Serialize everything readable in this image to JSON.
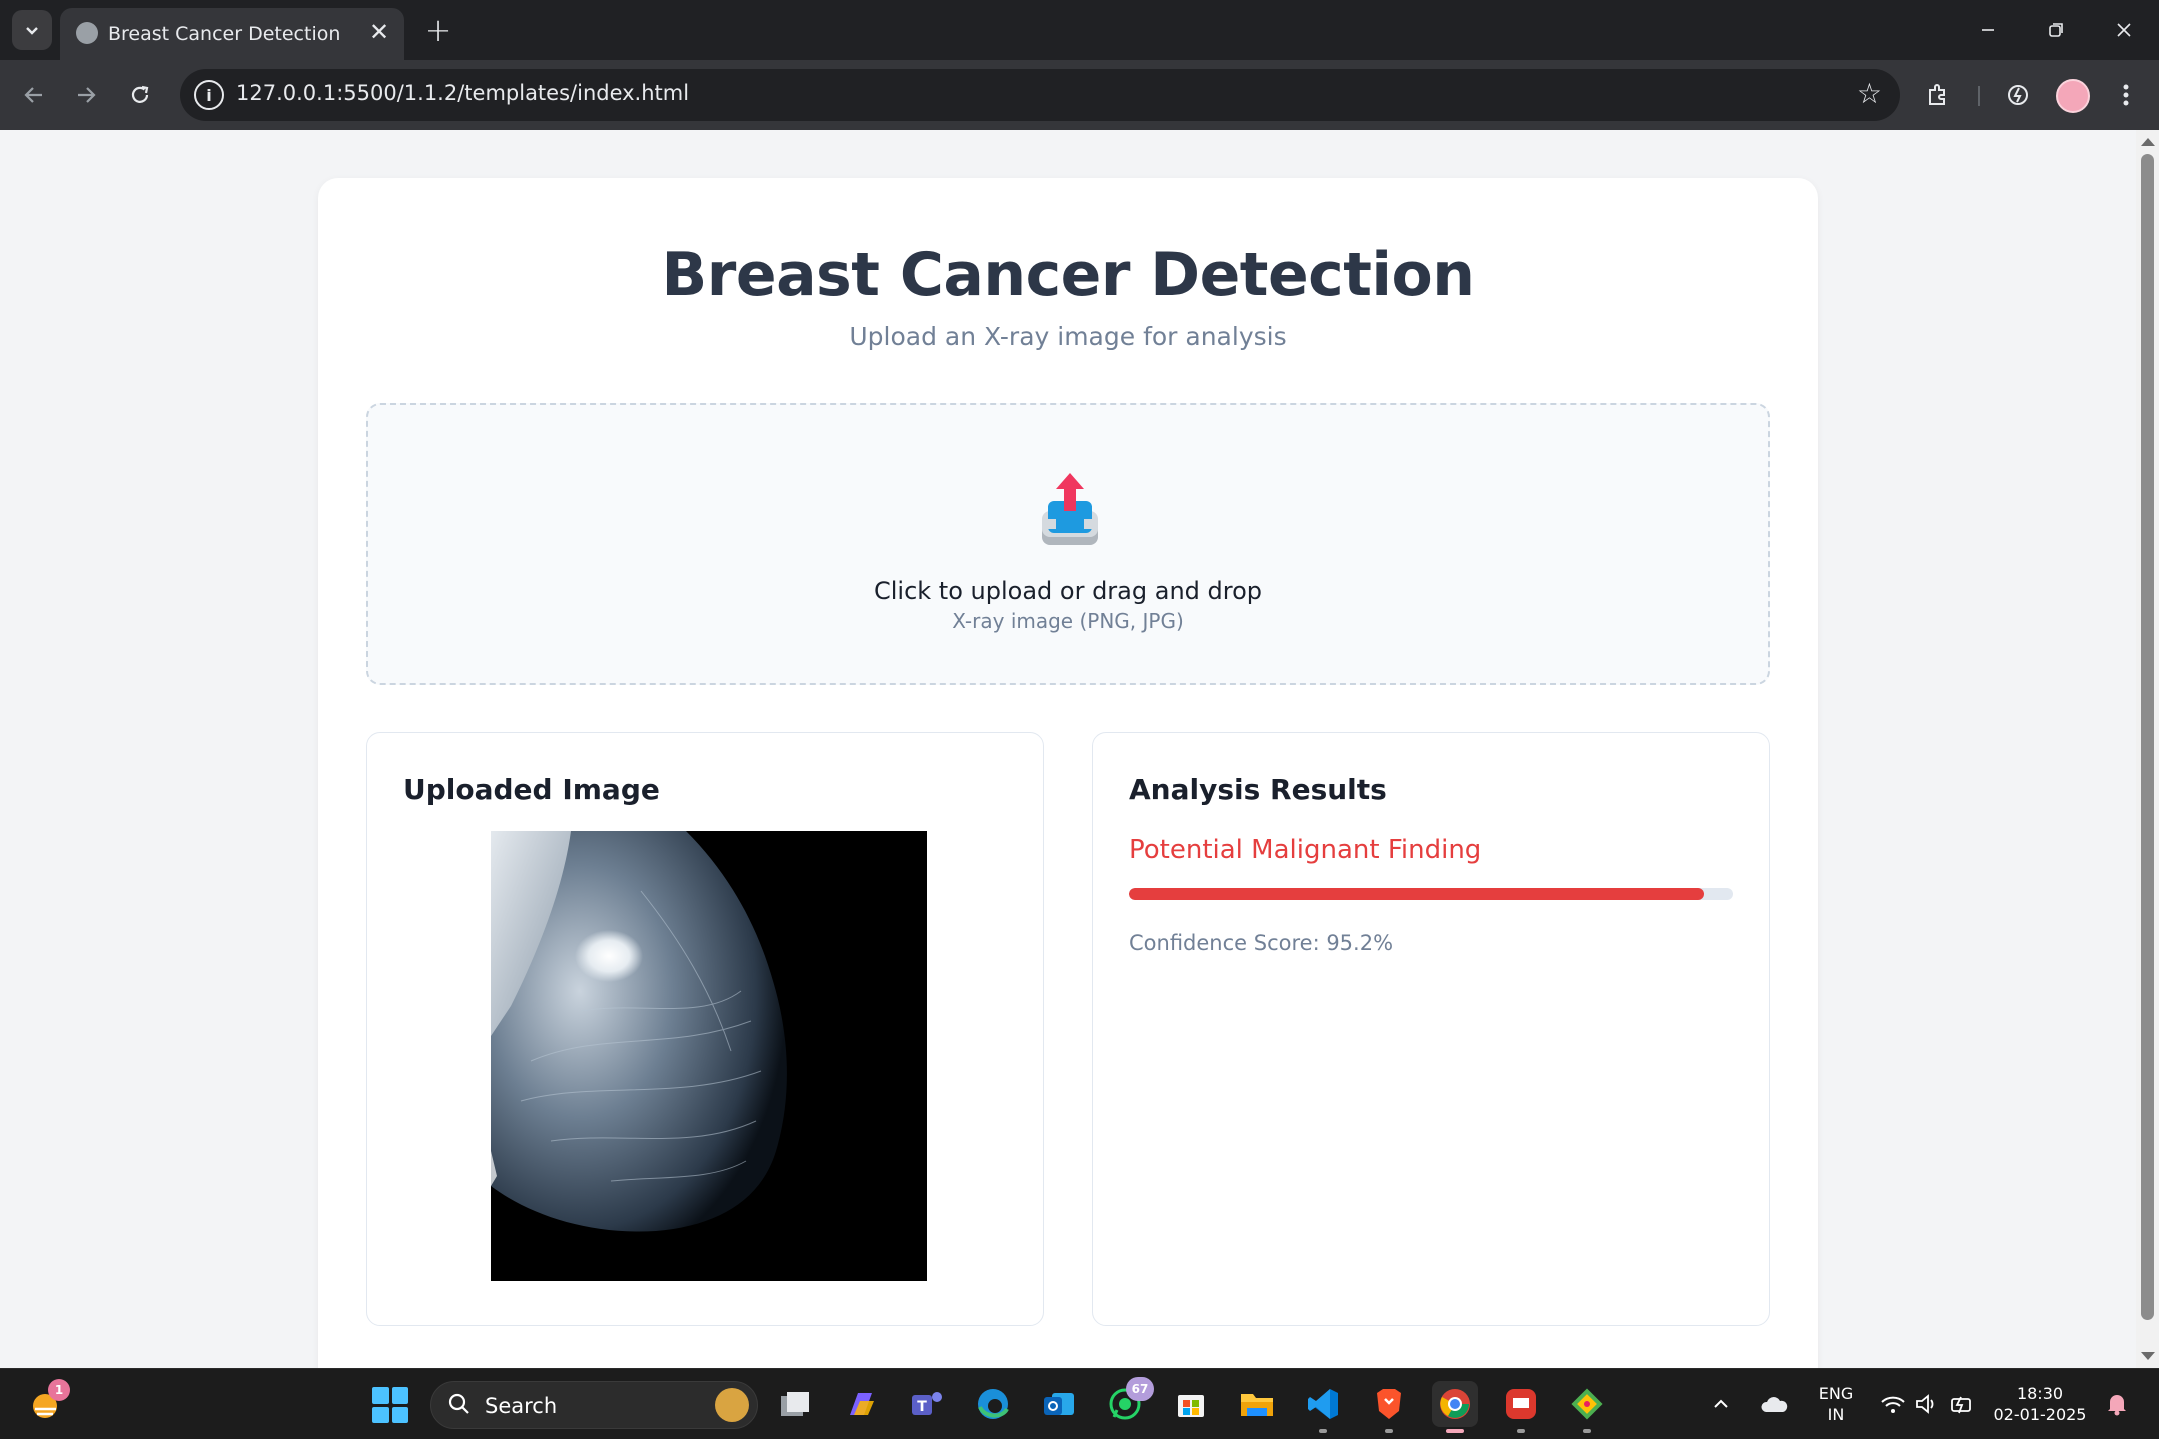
{
  "browser": {
    "tab_title": "Breast Cancer Detection",
    "url": "127.0.0.1:5500/1.1.2/templates/index.html",
    "new_tab_glyph": "+",
    "close_glyph": "✕"
  },
  "page": {
    "title": "Breast Cancer Detection",
    "subtitle": "Upload an X-ray image for analysis",
    "upload": {
      "main_text": "Click to upload or drag and drop",
      "sub_text": "X-ray image (PNG, JPG)",
      "icon": "upload-tray-icon"
    },
    "uploaded_panel": {
      "title": "Uploaded Image"
    },
    "results_panel": {
      "title": "Analysis Results",
      "finding": "Potential Malignant Finding",
      "confidence_text": "Confidence Score: 95.2%",
      "confidence_value": 0.952
    }
  },
  "colors": {
    "accent_danger": "#e53e3e",
    "title": "#2d3748",
    "muted": "#718096",
    "page_bg": "#f3f4f6"
  },
  "taskbar": {
    "search_label": "Search",
    "language_line1": "ENG",
    "language_line2": "IN",
    "time": "18:30",
    "date": "02-01-2025",
    "whatsapp_badge": "67",
    "widget_badge": "1",
    "apps": [
      "file-explorer-icon",
      "copilot-icon",
      "teams-icon",
      "edge-icon",
      "outlook-icon",
      "whatsapp-icon",
      "store-icon",
      "folder-icon",
      "vscode-icon",
      "brave-icon",
      "chrome-icon",
      "redis-icon",
      "git-icon"
    ]
  }
}
